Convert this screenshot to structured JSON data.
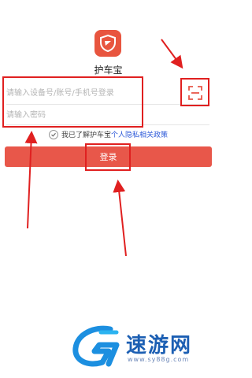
{
  "app": {
    "name": "护车宝"
  },
  "form": {
    "account_placeholder": "请输入设备号/账号/手机号登录",
    "password_placeholder": "请输入密码"
  },
  "agreement": {
    "prefix": "我已了解护车宝",
    "link": "个人隐私相关政策"
  },
  "login": {
    "label": "登录"
  },
  "icons": {
    "logo": "shield-icon",
    "scan": "scan-icon",
    "check": "check-circle-icon"
  },
  "colors": {
    "accent": "#e8574a",
    "link": "#2f5bd9",
    "annotation": "#e02020"
  },
  "watermark": {
    "title": "速游网",
    "url": "www.sy88g.com"
  }
}
